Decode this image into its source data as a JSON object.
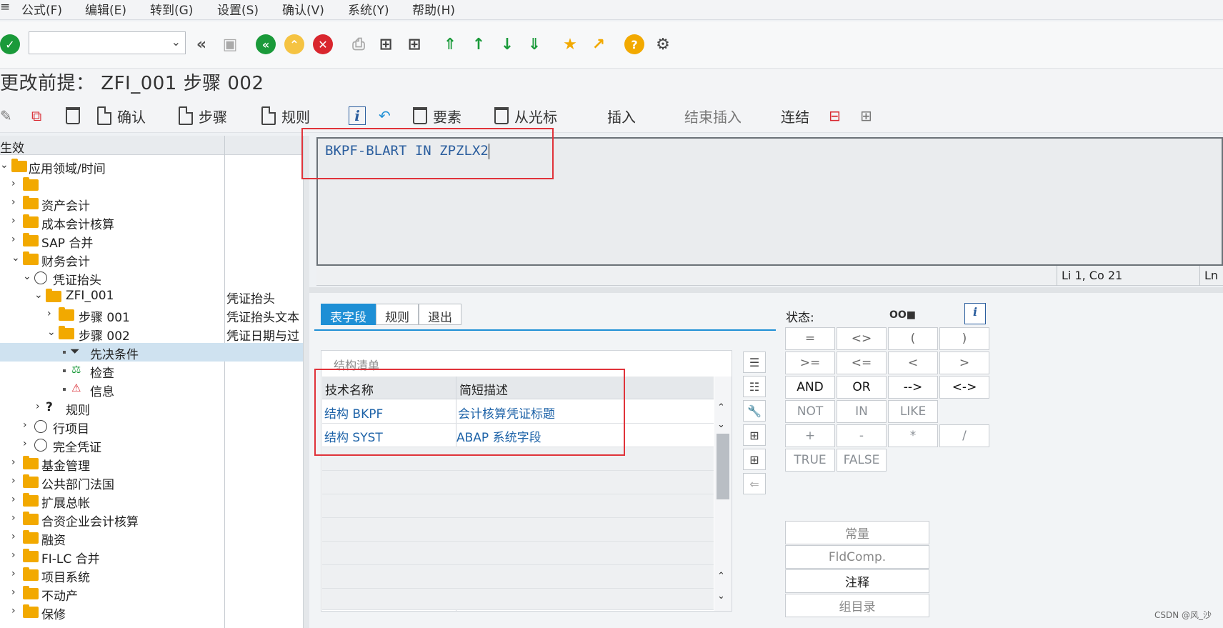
{
  "menu": [
    "公式(F)",
    "编辑(E)",
    "转到(G)",
    "设置(S)",
    "确认(V)",
    "系统(Y)",
    "帮助(H)"
  ],
  "toolbar": {
    "icons": [
      "enter-icon",
      "command-field",
      "back-icon",
      "save-icon",
      "green-back-icon",
      "exit-icon",
      "cancel-icon",
      "print-icon",
      "find-icon",
      "find-next-icon",
      "first-page-icon",
      "prev-page-icon",
      "next-page-icon",
      "last-page-icon",
      "new-session-icon",
      "shortcut-icon",
      "help-icon",
      "settings-icon"
    ],
    "colors": {
      "green": "#1a9a3a",
      "red": "#d9262e",
      "yellow": "#f2a900"
    }
  },
  "title": "更改前提： ZFI_001 步骤 002",
  "app_toolbar": {
    "confirm": "确认",
    "step": "步骤",
    "rule": "规则",
    "element": "要素",
    "from_cursor": "从光标",
    "insert": "插入",
    "end_insert": "结束插入",
    "link": "连结"
  },
  "tree": {
    "header": "生效",
    "rows": [
      {
        "label": "应用领域/时间",
        "desc": ""
      },
      {
        "label": "",
        "desc": ""
      },
      {
        "label": "资产会计",
        "desc": ""
      },
      {
        "label": "成本会计核算",
        "desc": ""
      },
      {
        "label": "SAP 合并",
        "desc": ""
      },
      {
        "label": "财务会计",
        "desc": ""
      },
      {
        "label": "凭证抬头",
        "desc": ""
      },
      {
        "label": "ZFI_001",
        "desc": "凭证抬头"
      },
      {
        "label": "步骤 001",
        "desc": "凭证抬头文本"
      },
      {
        "label": "步骤 002",
        "desc": "凭证日期与过"
      },
      {
        "label": "先决条件",
        "desc": ""
      },
      {
        "label": "检查",
        "desc": ""
      },
      {
        "label": "信息",
        "desc": ""
      },
      {
        "label": "规则",
        "desc": ""
      },
      {
        "label": "行项目",
        "desc": ""
      },
      {
        "label": "完全凭证",
        "desc": ""
      },
      {
        "label": "基金管理",
        "desc": ""
      },
      {
        "label": "公共部门法国",
        "desc": ""
      },
      {
        "label": "扩展总帐",
        "desc": ""
      },
      {
        "label": "合资企业会计核算",
        "desc": ""
      },
      {
        "label": "融资",
        "desc": ""
      },
      {
        "label": "FI-LC 合并",
        "desc": ""
      },
      {
        "label": "项目系统",
        "desc": ""
      },
      {
        "label": "不动产",
        "desc": ""
      },
      {
        "label": "保修",
        "desc": ""
      }
    ]
  },
  "editor": {
    "code": "BKPF-BLART IN ZPZLX2",
    "position": "Li 1, Co 21",
    "ln": "Ln"
  },
  "tabs": [
    "表字段",
    "规则",
    "退出"
  ],
  "structure": {
    "caption": "结构清单",
    "col_tech": "技术名称",
    "col_desc": "简短描述",
    "rows": [
      {
        "tech": "结构 BKPF",
        "desc": "会计核算凭证标题"
      },
      {
        "tech": "结构 SYST",
        "desc": "ABAP 系统字段"
      }
    ]
  },
  "status": {
    "label": "状态:",
    "leds": "OO■"
  },
  "operators": {
    "row1": [
      "=",
      "<>",
      "(",
      ")"
    ],
    "row2": [
      ">=",
      "<=",
      "<",
      ">"
    ],
    "row3": [
      "AND",
      "OR",
      "-->",
      "<->"
    ],
    "row4": [
      "NOT",
      "IN",
      "LIKE"
    ],
    "row5": [
      "+",
      "-",
      "*",
      "/"
    ],
    "row6": [
      "TRUE",
      "FALSE"
    ]
  },
  "big_buttons": [
    "常量",
    "FldComp.",
    "注释",
    "组目录"
  ],
  "watermark": "CSDN @风_沙"
}
